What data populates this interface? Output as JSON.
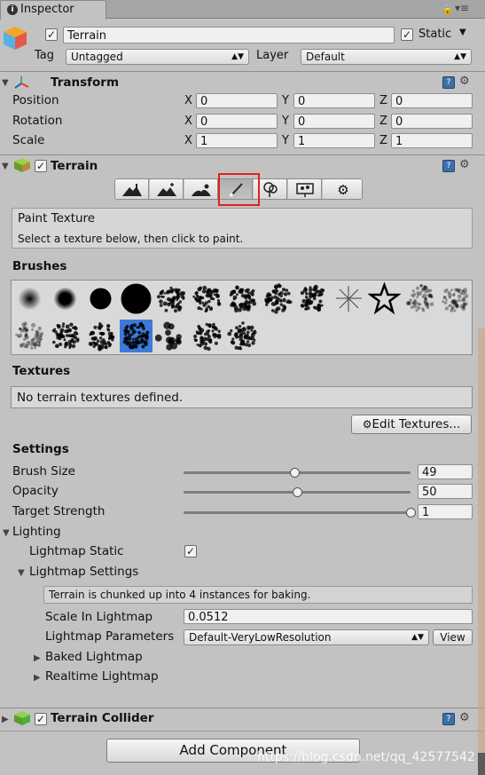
{
  "tab": {
    "title": "Inspector"
  },
  "object": {
    "name": "Terrain",
    "static_label": "Static",
    "tag_label": "Tag",
    "tag_value": "Untagged",
    "layer_label": "Layer",
    "layer_value": "Default"
  },
  "transform": {
    "title": "Transform",
    "rows": [
      {
        "label": "Position",
        "x": "0",
        "y": "0",
        "z": "0"
      },
      {
        "label": "Rotation",
        "x": "0",
        "y": "0",
        "z": "0"
      },
      {
        "label": "Scale",
        "x": "1",
        "y": "1",
        "z": "1"
      }
    ],
    "axis_x": "X",
    "axis_y": "Y",
    "axis_z": "Z"
  },
  "terrain": {
    "title": "Terrain",
    "tools": [
      "raise-lower-terrain",
      "paint-height",
      "smooth-height",
      "paint-texture",
      "place-trees",
      "paint-details",
      "terrain-settings"
    ],
    "selected_tool": "paint-texture",
    "tool_title": "Paint Texture",
    "tool_desc": "Select a texture below, then click to paint.",
    "brushes_label": "Brushes",
    "selected_brush_index": 16,
    "textures_label": "Textures",
    "no_textures": "No terrain textures defined.",
    "edit_textures": "Edit Textures...",
    "settings_label": "Settings",
    "brush_size_label": "Brush Size",
    "brush_size": "49",
    "brush_size_fraction": 0.49,
    "opacity_label": "Opacity",
    "opacity": "50",
    "opacity_fraction": 0.5,
    "target_strength_label": "Target Strength",
    "target_strength": "1",
    "target_strength_fraction": 1.0
  },
  "lighting": {
    "label": "Lighting",
    "lightmap_static_label": "Lightmap Static",
    "lightmap_settings_label": "Lightmap Settings",
    "info": "Terrain is chunked up into 4 instances for baking.",
    "scale_label": "Scale In Lightmap",
    "scale_value": "0.0512",
    "params_label": "Lightmap Parameters",
    "params_value": "Default-VeryLowResolution",
    "view_label": "View",
    "baked_label": "Baked Lightmap",
    "realtime_label": "Realtime Lightmap"
  },
  "collider": {
    "title": "Terrain Collider"
  },
  "add_component": "Add Component",
  "watermark": "https://blog.csdn.net/qq_42577542"
}
